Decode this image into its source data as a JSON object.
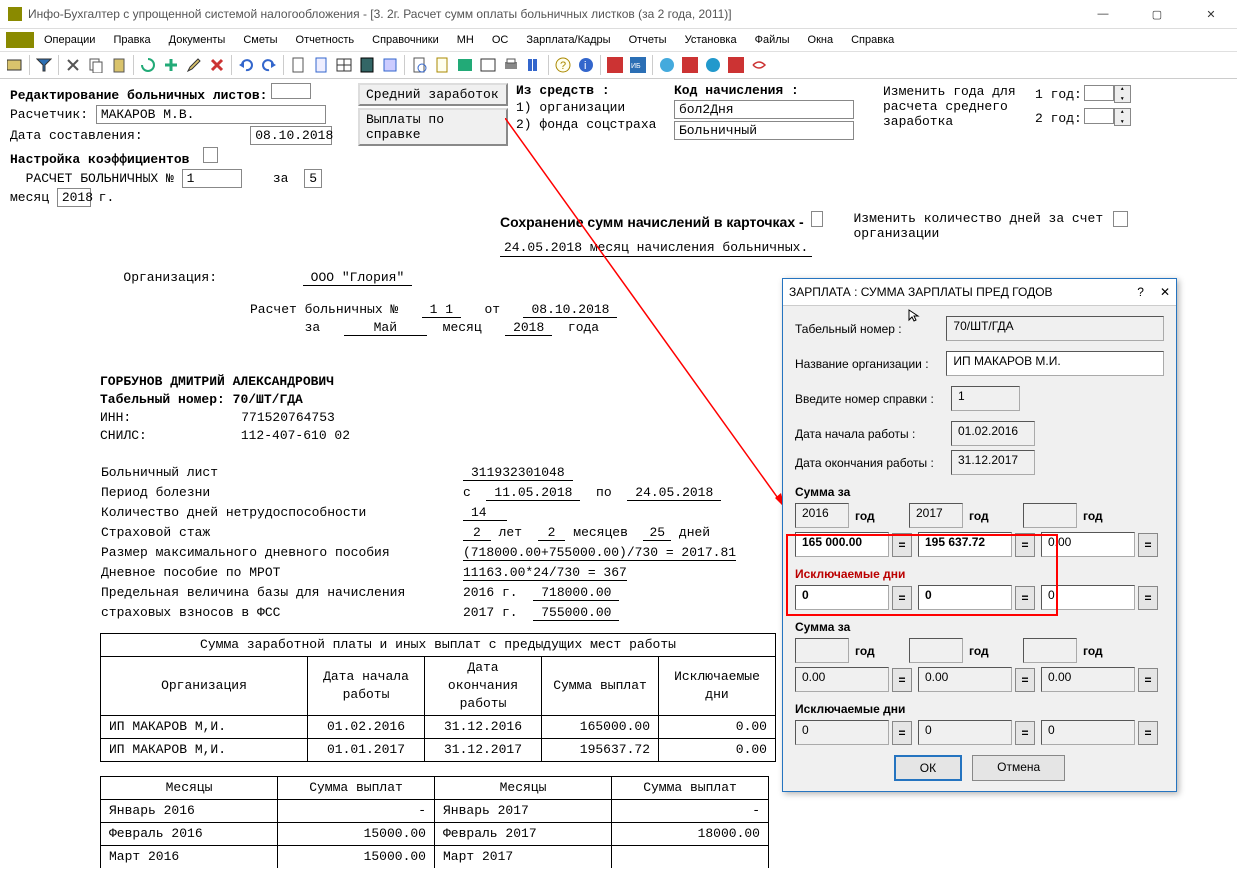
{
  "app": {
    "title": "Инфо-Бухгалтер с упрощенной системой налогообложения - [3. 2г. Расчет сумм оплаты больничных листков (за 2 года, 2011)]"
  },
  "menu": {
    "items": [
      "Операции",
      "Правка",
      "Документы",
      "Сметы",
      "Отчетность",
      "Справочники",
      "МН",
      "ОС",
      "Зарплата/Кадры",
      "Отчеты",
      "Установка",
      "Файлы",
      "Окна",
      "Справка"
    ]
  },
  "top": {
    "edit_header": "Редактирование больничных листов:",
    "calc_lbl": "Расчетчик:",
    "calc_val": "МАКАРОВ М.В.",
    "date_lbl": "Дата составления:",
    "date_val": "08.10.2018",
    "coef_lbl": "Настройка коэффициентов",
    "rasch_lbl": "РАСЧЕТ БОЛЬНИЧНЫХ №",
    "rasch_no": "1",
    "za": "за",
    "mon_no": "5",
    "mon_lbl": "месяц",
    "year": "2018",
    "g": "г.",
    "avg_btn": "Средний заработок",
    "pay_btn": "Выплаты по справке",
    "from_lbl": "Из средств :",
    "org1": "1) организации",
    "org2": "2) фонда соцстраха",
    "code_lbl": "Код начисления :",
    "code1": "бол2Дня",
    "code2": "Больничный",
    "change_years": "Изменить года для расчета среднего заработка",
    "y1": "1 год:",
    "y2": "2 год:",
    "save_hdr": "Сохранение сумм начислений в карточках -",
    "line2": "24.05.2018 месяц начисления больничных.",
    "change_days": "Изменить количество дней за счет организации"
  },
  "doc": {
    "org_lbl": "Организация:",
    "org_val": "ООО \"Глория\"",
    "num_lbl": "Расчет больничных №",
    "num": "1 1",
    "ot": "от",
    "date": "08.10.2018",
    "za": "за",
    "month_name": "Май",
    "mes": "месяц",
    "year": "2018",
    "goda": "года",
    "person": "ГОРБУНОВ ДМИТРИЙ АЛЕКСАНДРОВИЧ",
    "tab_lbl": "Табельный номер:",
    "tab": "70/ШТ/ГДА",
    "inn_lbl": "ИНН:",
    "inn": "771520764753",
    "snils_lbl": "СНИЛС:",
    "snils": "112-407-610 02",
    "bl_lbl": "Больничный лист",
    "bl": "311932301048",
    "period_lbl": "Период болезни",
    "c": "с",
    "d1": "11.05.2018",
    "po": "по",
    "d2": "24.05.2018",
    "days_lbl": "Количество дней нетрудоспособности",
    "days": "14",
    "stazh_lbl": "Страховой стаж",
    "st_y": "2",
    "st_yl": "лет",
    "st_m": "2",
    "st_ml": "месяцев",
    "st_d": "25",
    "st_dl": "дней",
    "max_lbl": "Размер максимального дневного пособия",
    "max_val": "(718000.00+755000.00)/730 = 2017.81",
    "mrot_lbl": "Дневное пособие по МРОТ",
    "mrot_val": "11163.00*24/730 =  367",
    "lim_lbl1": "Предельная величина базы для начисления",
    "lim_lbl2": "страховых взносов в ФСС",
    "lim_y1": "2016 г.",
    "lim_v1": "718000.00",
    "lim_y2": "2017 г.",
    "lim_v2": "755000.00",
    "tbl_hdr": "Сумма заработной платы и иных выплат с предыдущих мест работы",
    "tbl_cols": [
      "Организация",
      "Дата начала работы",
      "Дата окончания работы",
      "Сумма выплат",
      "Исключаемые дни"
    ],
    "tbl_rows": [
      [
        "ИП МАКАРОВ М,И.",
        "01.02.2016",
        "31.12.2016",
        "165000.00",
        "0.00"
      ],
      [
        "ИП МАКАРОВ М,И.",
        "01.01.2017",
        "31.12.2017",
        "195637.72",
        "0.00"
      ]
    ],
    "tbl2_cols": [
      "Месяцы",
      "Сумма выплат",
      "Месяцы",
      "Сумма выплат"
    ],
    "tbl2_rows": [
      [
        "Январь 2016",
        "-",
        "Январь 2017",
        "-"
      ],
      [
        "Февраль 2016",
        "15000.00",
        "Февраль 2017",
        "18000.00"
      ],
      [
        "Март 2016",
        "15000.00",
        "Март 2017",
        ""
      ]
    ]
  },
  "dlg": {
    "title": "ЗАРПЛАТА : СУММА ЗАРПЛАТЫ ПРЕД ГОДОВ",
    "tab_lbl": "Табельный номер  :",
    "tab": "70/ШТ/ГДА",
    "org_lbl": "Название организации  :",
    "org": "ИП МАКАРОВ М.И.",
    "ref_lbl": "Введите номер справки   :",
    "ref": "1",
    "ds_lbl": "Дата начала работы    :",
    "ds": "01.02.2016",
    "de_lbl": "Дата окончания работы  :",
    "de": "31.12.2017",
    "sum_hdr": "Сумма за",
    "y1": "2016",
    "y2": "2017",
    "god": "год",
    "s1": "165 000.00",
    "s2": "195 637.72",
    "s3": "0.00",
    "excl": "Исключаемые дни",
    "e1": "0",
    "e2": "0",
    "e3": "0",
    "sum_hdr2": "Сумма за",
    "b1": "0.00",
    "b2": "0.00",
    "b3": "0.00",
    "excl2": "Исключаемые дни",
    "f1": "0",
    "f2": "0",
    "f3": "0",
    "ok": "ОК",
    "cancel": "Отмена"
  }
}
